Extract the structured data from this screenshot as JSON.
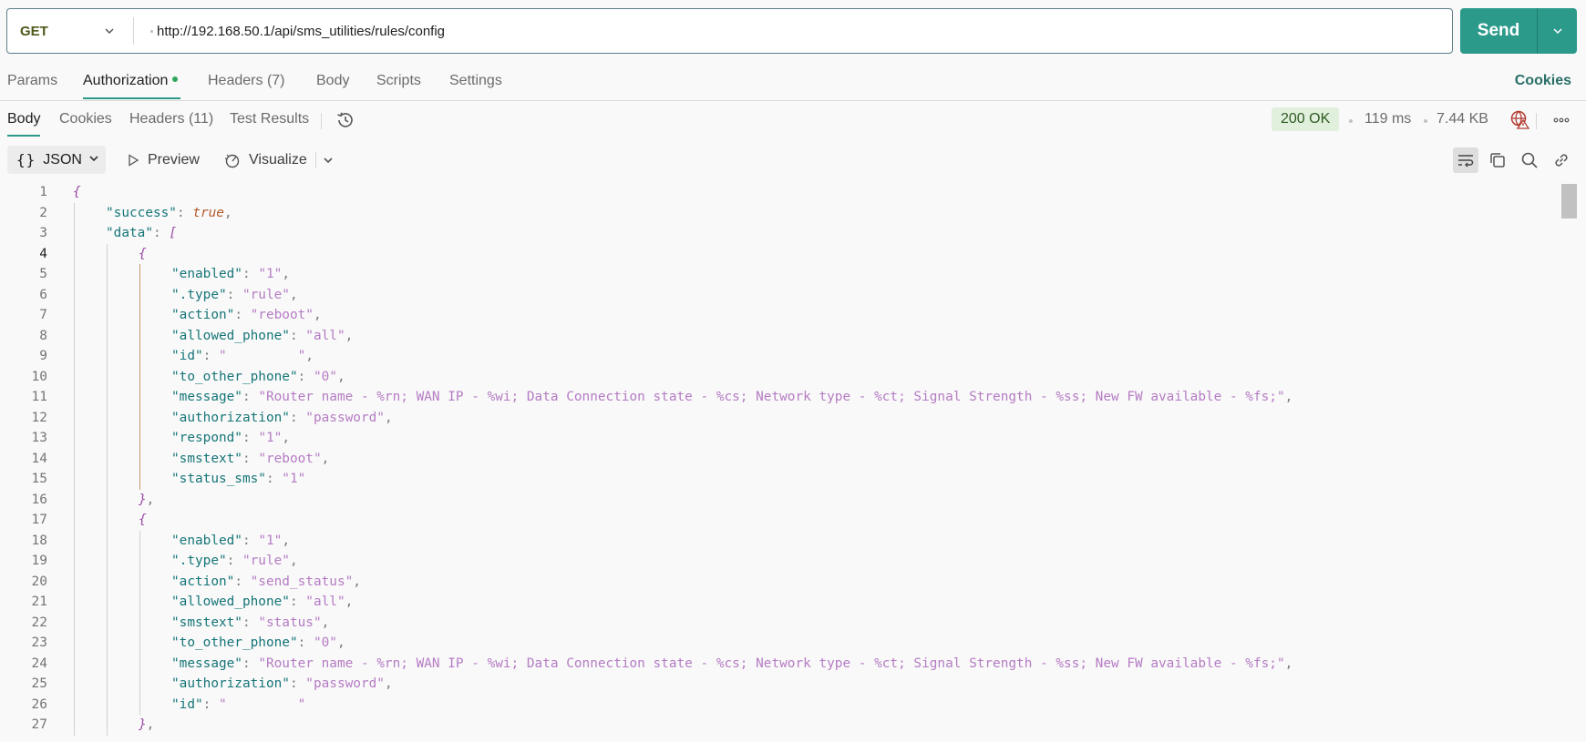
{
  "request": {
    "method": "GET",
    "url": "http://192.168.50.1/api/sms_utilities/rules/config",
    "send_label": "Send"
  },
  "request_tabs": {
    "params": "Params",
    "authorization": "Authorization",
    "headers": "Headers",
    "headers_count": "(7)",
    "body": "Body",
    "scripts": "Scripts",
    "settings": "Settings",
    "cookies": "Cookies"
  },
  "response_tabs": {
    "body": "Body",
    "cookies": "Cookies",
    "headers": "Headers",
    "headers_count": "(11)",
    "test_results": "Test Results"
  },
  "response_meta": {
    "status": "200 OK",
    "time": "119 ms",
    "size": "7.44 KB"
  },
  "viewer": {
    "format": "JSON",
    "preview": "Preview",
    "visualize": "Visualize"
  },
  "code_lines": [
    {
      "n": "1",
      "indent": 0,
      "tokens": [
        {
          "c": "br",
          "t": "{"
        }
      ]
    },
    {
      "n": "2",
      "indent": 1,
      "tokens": [
        {
          "c": "k",
          "t": "\"success\""
        },
        {
          "c": "p",
          "t": ": "
        },
        {
          "c": "b",
          "t": "true"
        },
        {
          "c": "p",
          "t": ","
        }
      ]
    },
    {
      "n": "3",
      "indent": 1,
      "tokens": [
        {
          "c": "k",
          "t": "\"data\""
        },
        {
          "c": "p",
          "t": ": "
        },
        {
          "c": "br",
          "t": "["
        }
      ]
    },
    {
      "n": "4",
      "indent": 2,
      "tokens": [
        {
          "c": "br",
          "t": "{"
        }
      ]
    },
    {
      "n": "5",
      "indent": 3,
      "tokens": [
        {
          "c": "k",
          "t": "\"enabled\""
        },
        {
          "c": "p",
          "t": ": "
        },
        {
          "c": "s",
          "t": "\"1\""
        },
        {
          "c": "p",
          "t": ","
        }
      ]
    },
    {
      "n": "6",
      "indent": 3,
      "tokens": [
        {
          "c": "k",
          "t": "\".type\""
        },
        {
          "c": "p",
          "t": ": "
        },
        {
          "c": "s",
          "t": "\"rule\""
        },
        {
          "c": "p",
          "t": ","
        }
      ]
    },
    {
      "n": "7",
      "indent": 3,
      "tokens": [
        {
          "c": "k",
          "t": "\"action\""
        },
        {
          "c": "p",
          "t": ": "
        },
        {
          "c": "s",
          "t": "\"reboot\""
        },
        {
          "c": "p",
          "t": ","
        }
      ]
    },
    {
      "n": "8",
      "indent": 3,
      "tokens": [
        {
          "c": "k",
          "t": "\"allowed_phone\""
        },
        {
          "c": "p",
          "t": ": "
        },
        {
          "c": "s",
          "t": "\"all\""
        },
        {
          "c": "p",
          "t": ","
        }
      ]
    },
    {
      "n": "9",
      "indent": 3,
      "tokens": [
        {
          "c": "k",
          "t": "\"id\""
        },
        {
          "c": "p",
          "t": ": "
        },
        {
          "c": "s",
          "t": "\"         \""
        },
        {
          "c": "p",
          "t": ","
        }
      ]
    },
    {
      "n": "10",
      "indent": 3,
      "tokens": [
        {
          "c": "k",
          "t": "\"to_other_phone\""
        },
        {
          "c": "p",
          "t": ": "
        },
        {
          "c": "s",
          "t": "\"0\""
        },
        {
          "c": "p",
          "t": ","
        }
      ]
    },
    {
      "n": "11",
      "indent": 3,
      "tokens": [
        {
          "c": "k",
          "t": "\"message\""
        },
        {
          "c": "p",
          "t": ": "
        },
        {
          "c": "s",
          "t": "\"Router name - %rn; WAN IP - %wi; Data Connection state - %cs; Network type - %ct; Signal Strength - %ss; New FW available - %fs;\""
        },
        {
          "c": "p",
          "t": ","
        }
      ]
    },
    {
      "n": "12",
      "indent": 3,
      "tokens": [
        {
          "c": "k",
          "t": "\"authorization\""
        },
        {
          "c": "p",
          "t": ": "
        },
        {
          "c": "s",
          "t": "\"password\""
        },
        {
          "c": "p",
          "t": ","
        }
      ]
    },
    {
      "n": "13",
      "indent": 3,
      "tokens": [
        {
          "c": "k",
          "t": "\"respond\""
        },
        {
          "c": "p",
          "t": ": "
        },
        {
          "c": "s",
          "t": "\"1\""
        },
        {
          "c": "p",
          "t": ","
        }
      ]
    },
    {
      "n": "14",
      "indent": 3,
      "tokens": [
        {
          "c": "k",
          "t": "\"smstext\""
        },
        {
          "c": "p",
          "t": ": "
        },
        {
          "c": "s",
          "t": "\"reboot\""
        },
        {
          "c": "p",
          "t": ","
        }
      ]
    },
    {
      "n": "15",
      "indent": 3,
      "tokens": [
        {
          "c": "k",
          "t": "\"status_sms\""
        },
        {
          "c": "p",
          "t": ": "
        },
        {
          "c": "s",
          "t": "\"1\""
        }
      ]
    },
    {
      "n": "16",
      "indent": 2,
      "tokens": [
        {
          "c": "br",
          "t": "}"
        },
        {
          "c": "p",
          "t": ","
        }
      ]
    },
    {
      "n": "17",
      "indent": 2,
      "tokens": [
        {
          "c": "br",
          "t": "{"
        }
      ]
    },
    {
      "n": "18",
      "indent": 3,
      "tokens": [
        {
          "c": "k",
          "t": "\"enabled\""
        },
        {
          "c": "p",
          "t": ": "
        },
        {
          "c": "s",
          "t": "\"1\""
        },
        {
          "c": "p",
          "t": ","
        }
      ]
    },
    {
      "n": "19",
      "indent": 3,
      "tokens": [
        {
          "c": "k",
          "t": "\".type\""
        },
        {
          "c": "p",
          "t": ": "
        },
        {
          "c": "s",
          "t": "\"rule\""
        },
        {
          "c": "p",
          "t": ","
        }
      ]
    },
    {
      "n": "20",
      "indent": 3,
      "tokens": [
        {
          "c": "k",
          "t": "\"action\""
        },
        {
          "c": "p",
          "t": ": "
        },
        {
          "c": "s",
          "t": "\"send_status\""
        },
        {
          "c": "p",
          "t": ","
        }
      ]
    },
    {
      "n": "21",
      "indent": 3,
      "tokens": [
        {
          "c": "k",
          "t": "\"allowed_phone\""
        },
        {
          "c": "p",
          "t": ": "
        },
        {
          "c": "s",
          "t": "\"all\""
        },
        {
          "c": "p",
          "t": ","
        }
      ]
    },
    {
      "n": "22",
      "indent": 3,
      "tokens": [
        {
          "c": "k",
          "t": "\"smstext\""
        },
        {
          "c": "p",
          "t": ": "
        },
        {
          "c": "s",
          "t": "\"status\""
        },
        {
          "c": "p",
          "t": ","
        }
      ]
    },
    {
      "n": "23",
      "indent": 3,
      "tokens": [
        {
          "c": "k",
          "t": "\"to_other_phone\""
        },
        {
          "c": "p",
          "t": ": "
        },
        {
          "c": "s",
          "t": "\"0\""
        },
        {
          "c": "p",
          "t": ","
        }
      ]
    },
    {
      "n": "24",
      "indent": 3,
      "tokens": [
        {
          "c": "k",
          "t": "\"message\""
        },
        {
          "c": "p",
          "t": ": "
        },
        {
          "c": "s",
          "t": "\"Router name - %rn; WAN IP - %wi; Data Connection state - %cs; Network type - %ct; Signal Strength - %ss; New FW available - %fs;\""
        },
        {
          "c": "p",
          "t": ","
        }
      ]
    },
    {
      "n": "25",
      "indent": 3,
      "tokens": [
        {
          "c": "k",
          "t": "\"authorization\""
        },
        {
          "c": "p",
          "t": ": "
        },
        {
          "c": "s",
          "t": "\"password\""
        },
        {
          "c": "p",
          "t": ","
        }
      ]
    },
    {
      "n": "26",
      "indent": 3,
      "tokens": [
        {
          "c": "k",
          "t": "\"id\""
        },
        {
          "c": "p",
          "t": ": "
        },
        {
          "c": "s",
          "t": "\"         \""
        }
      ]
    },
    {
      "n": "27",
      "indent": 2,
      "tokens": [
        {
          "c": "br",
          "t": "}"
        },
        {
          "c": "p",
          "t": ","
        }
      ]
    }
  ]
}
